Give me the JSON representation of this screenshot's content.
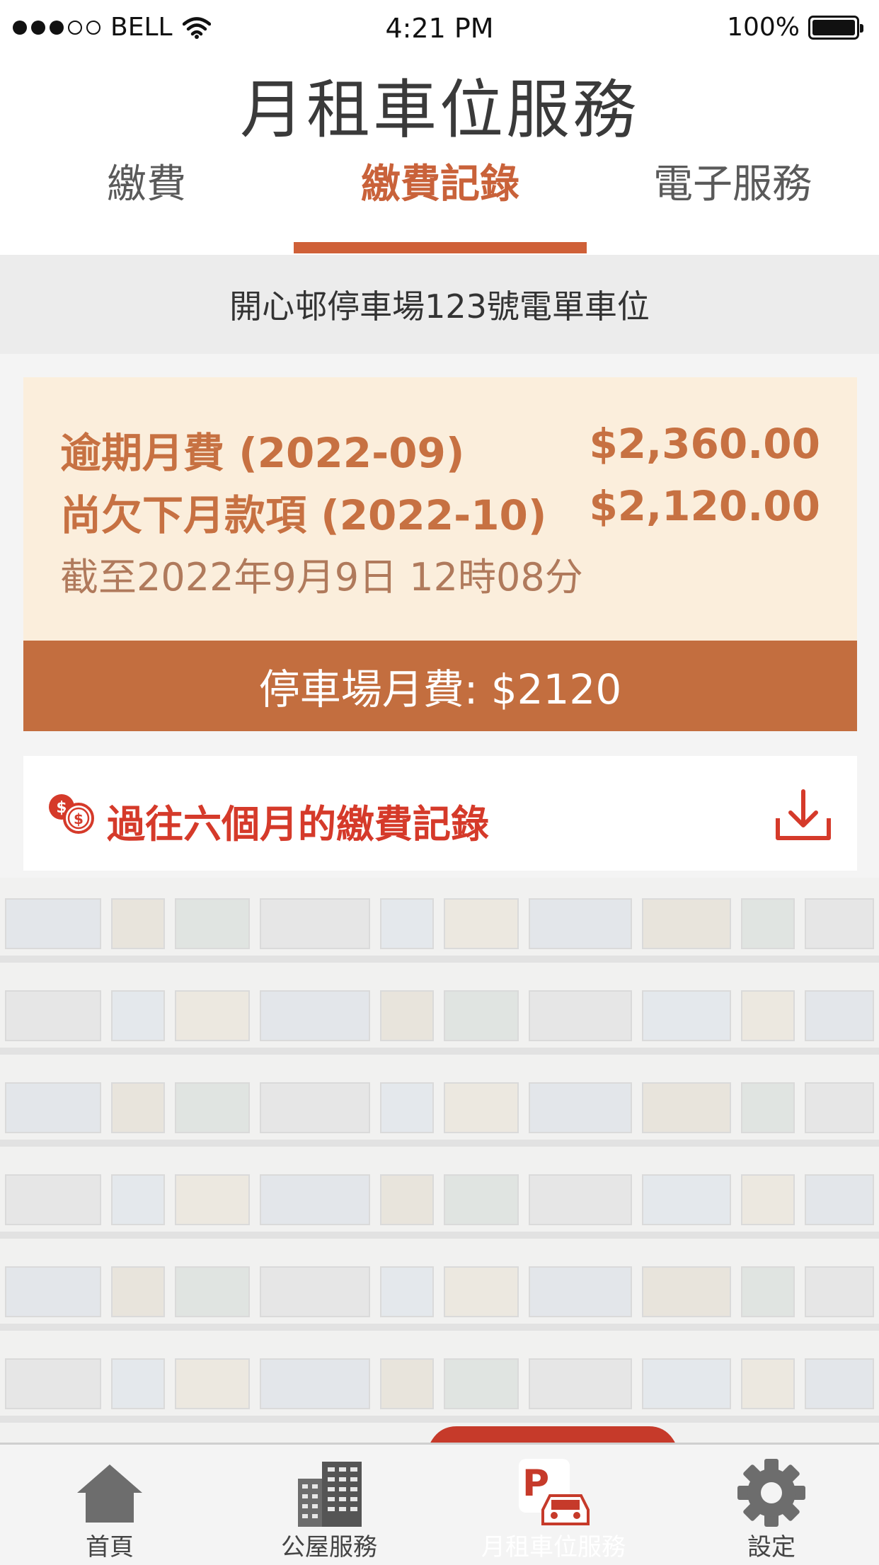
{
  "status_bar": {
    "carrier": "BELL",
    "time": "4:21 PM",
    "battery": "100%"
  },
  "header": {
    "title": "月租車位服務",
    "tabs": [
      {
        "label": "繳費",
        "active": false
      },
      {
        "label": "繳費記錄",
        "active": true
      },
      {
        "label": "電子服務",
        "active": false
      }
    ]
  },
  "address": "開心邨停車場123號電單車位",
  "payment": {
    "overdue_label": "逾期月費 (2022-09)",
    "overdue_amount": "$2,360.00",
    "next_label": "尚欠下月款項 (2022-10)",
    "next_amount": "$2,120.00",
    "as_of": "截至2022年9月9日 12時08分",
    "monthly_fee": "停車場月費: $2120"
  },
  "history": {
    "label": "過往六個月的繳費記錄"
  },
  "bottom_nav": [
    {
      "label": "首頁",
      "icon": "home-icon"
    },
    {
      "label": "公屋服務",
      "icon": "building-icon"
    },
    {
      "label": "月租車位服務",
      "icon": "parking-car-icon",
      "active": true
    },
    {
      "label": "設定",
      "icon": "gear-icon"
    }
  ],
  "colors": {
    "accent": "#cf6038",
    "card_bg": "#fbeedc",
    "fee_bar": "#c36e3f",
    "history_text": "#d53a2a",
    "nav_active": "#c63a2a"
  }
}
